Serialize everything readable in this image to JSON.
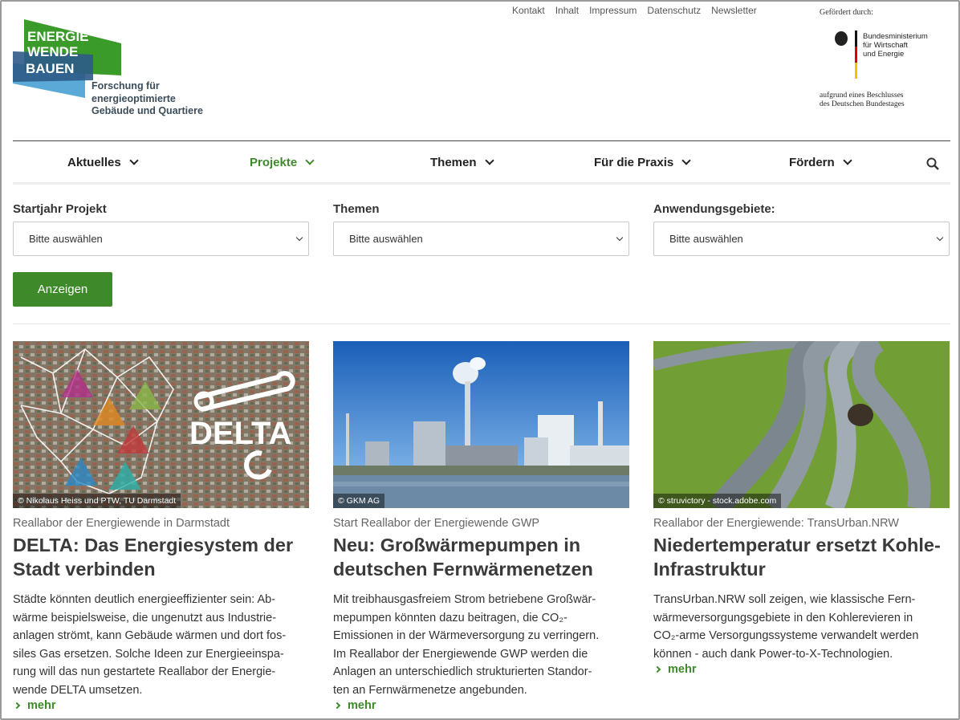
{
  "topnav": [
    "Kontakt",
    "Inhalt",
    "Impressum",
    "Datenschutz",
    "Newsletter"
  ],
  "logo": {
    "line1": "ENERGIE",
    "line2": "WENDE",
    "line3": "BAUEN",
    "sub": [
      "Forschung für",
      "energieoptimierte",
      "Gebäude und Quartiere"
    ]
  },
  "sponsor": {
    "label": "Gefördert durch:",
    "ministry": [
      "Bundesministerium",
      "für Wirtschaft",
      "und Energie"
    ],
    "note": [
      "aufgrund eines Beschlusses",
      "des Deutschen Bundestages"
    ]
  },
  "mainnav": [
    "Aktuelles",
    "Projekte",
    "Themen",
    "Für die Praxis",
    "Fördern"
  ],
  "filters": [
    {
      "label": "Startjahr Projekt",
      "value": "Bitte auswählen"
    },
    {
      "label": "Themen",
      "value": "Bitte auswählen"
    },
    {
      "label": "Anwendungsgebiete:",
      "value": "Bitte auswählen"
    }
  ],
  "show_button": "Anzeigen",
  "cards": [
    {
      "credit": "© Nikolaus Heiss und PTW, TU Darmstadt",
      "image_text": "DELTA",
      "kicker": "Reallabor der Energiewende in Darmstadt",
      "title": "DELTA: Das Energiesystem der Stadt verbinden",
      "text": [
        "Städte könnten deutlich energieeffizienter sein: Ab-",
        "wärme beispielsweise, die ungenutzt aus Industrie-",
        "anlagen strömt, kann Gebäude wärmen und dort fos-",
        "siles Gas ersetzen. Solche Ideen zur Energieeinspa-",
        "rung will das nun gestartete Reallabor der Energie-",
        "wende DELTA umsetzen."
      ],
      "more": "mehr"
    },
    {
      "credit": "© GKM AG",
      "kicker": "Start Reallabor der Energiewende GWP",
      "title": "Neu: Großwärmepumpen in deutschen Fernwärmenetzen",
      "text": [
        "Mit treibhausgasfreiem Strom betriebene Großwär-",
        "mepumpen könnten dazu beitragen, die CO₂-",
        "Emissionen in der Wärmeversorgung zu verringern.",
        "Im Reallabor der Energiewende GWP werden die",
        "Anlagen an  unterschiedlich strukturierten Standor-",
        "ten an Fernwärmenetze angebunden."
      ],
      "more": "mehr"
    },
    {
      "credit": "© struvictory - stock.adobe.com",
      "kicker": "Reallabor der Energiewende: TransUrban.NRW",
      "title": "Niedertemperatur ersetzt Kohle-Infrastruktur",
      "text": [
        "TransUrban.NRW soll zeigen, wie klassische Fern-",
        "wärmeversorgungsgebiete in den Kohlerevieren in",
        "CO₂-arme Versorgungssysteme verwandelt werden",
        "können - auch dank Power-to-X-Technologien."
      ],
      "more": "mehr"
    }
  ],
  "colors": {
    "accent": "#3e8a2b",
    "logo_green": "#3a9a2a",
    "logo_blue": "#1f6aa8"
  }
}
